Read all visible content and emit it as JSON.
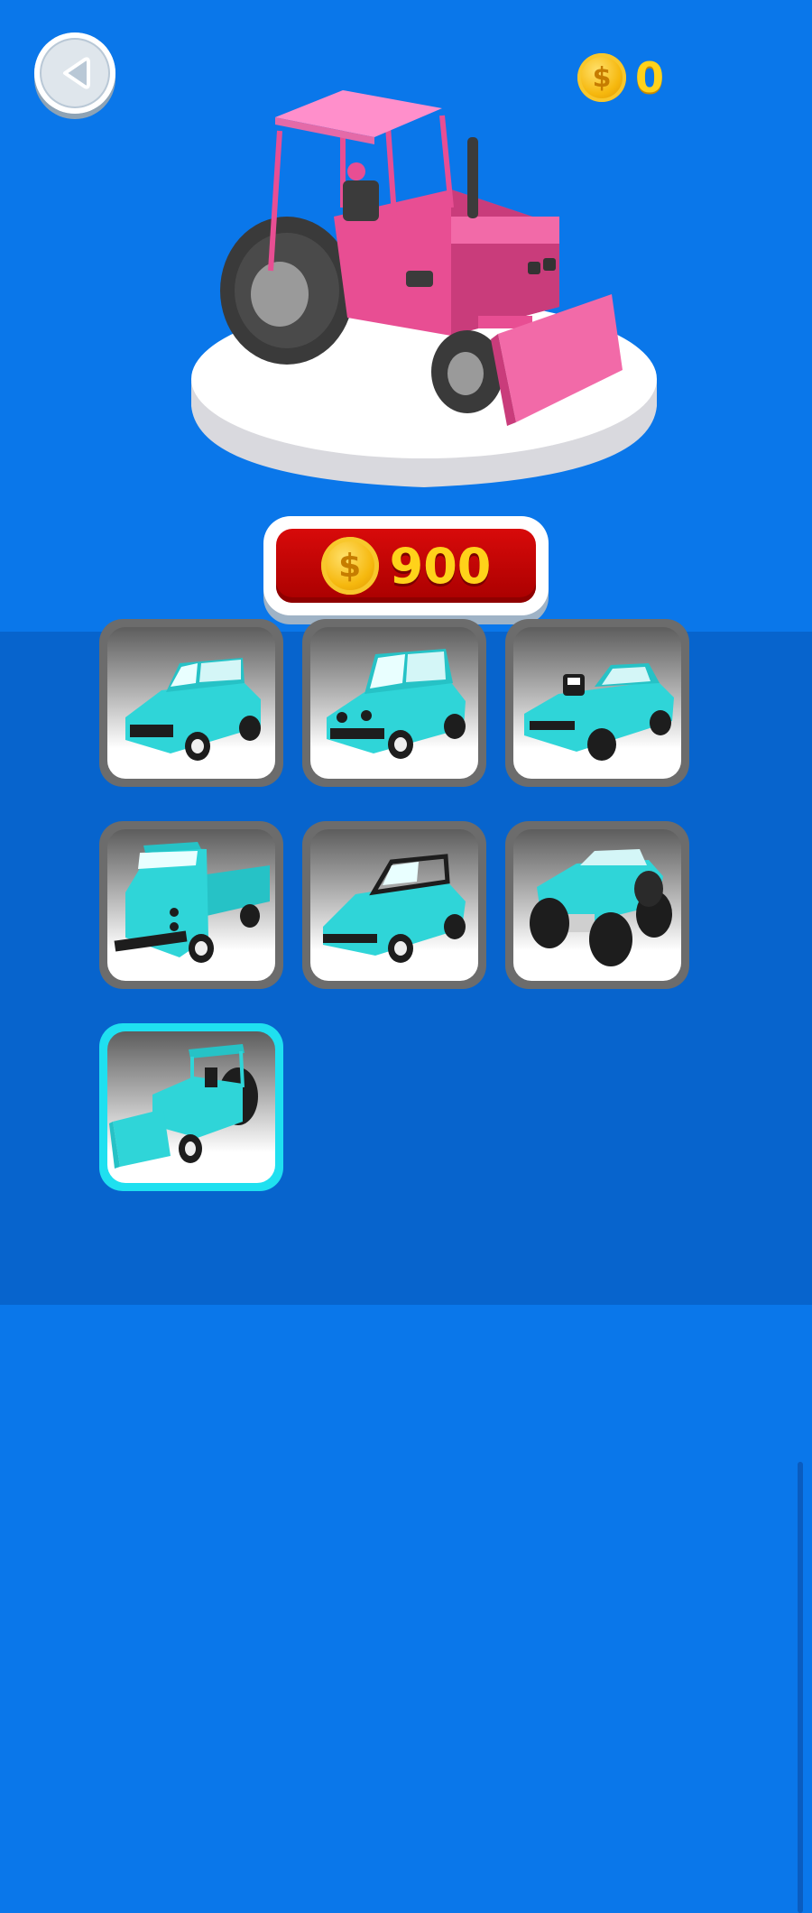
{
  "header": {
    "back_icon": "back-arrow-icon",
    "coins": {
      "icon": "coin-icon",
      "symbol": "$",
      "count": "0"
    }
  },
  "showcase": {
    "vehicle": "tractor-with-blade",
    "color": "#f0529b",
    "platform_color": "#ffffff"
  },
  "purchase": {
    "icon": "coin-icon",
    "symbol": "$",
    "price": "900",
    "button_color": "#c90000",
    "text_color": "#ffd21a"
  },
  "vehicle_grid": {
    "vehicle_color": "#2fd5d8",
    "selected_border_color": "#1fe0f0",
    "items": [
      {
        "name": "suv",
        "selected": false
      },
      {
        "name": "jeep",
        "selected": false
      },
      {
        "name": "muscle-car",
        "selected": false
      },
      {
        "name": "dump-truck",
        "selected": false
      },
      {
        "name": "offroad-buggy",
        "selected": false
      },
      {
        "name": "monster-truck",
        "selected": false
      },
      {
        "name": "tractor",
        "selected": true
      }
    ]
  },
  "colors": {
    "background": "#0a77ea",
    "grid_panel": "#0764cd",
    "coin": "#f6b80e"
  }
}
